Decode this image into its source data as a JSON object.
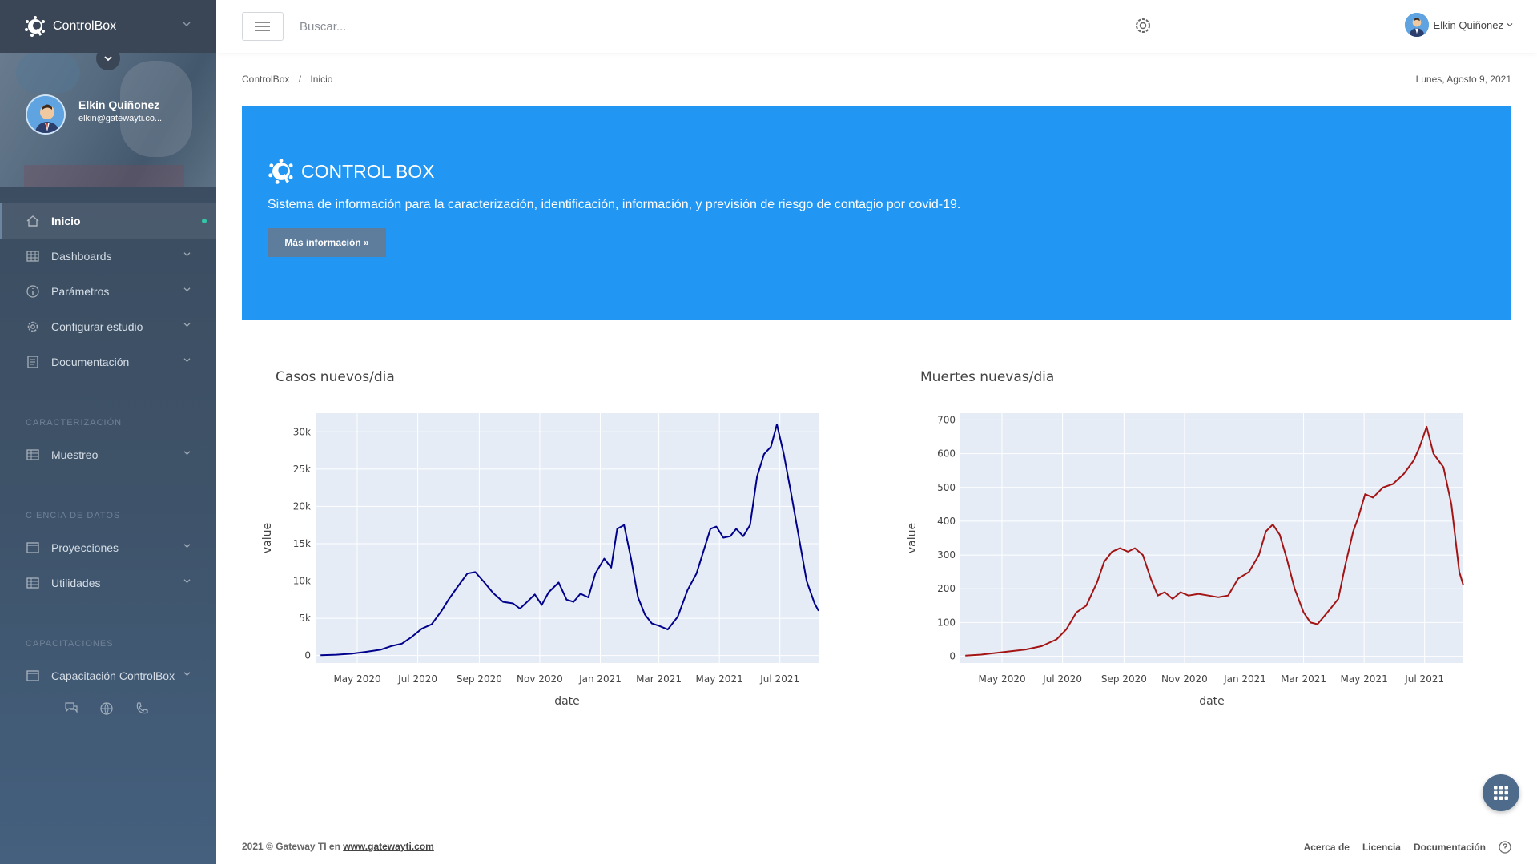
{
  "app": {
    "brand_name": "ControlBox"
  },
  "sidebar": {
    "user_name": "Elkin Quiñonez",
    "user_email": "elkin@gatewayti.co...",
    "items_main": [
      {
        "label": "Inicio",
        "icon": "home-icon",
        "active": true
      },
      {
        "label": "Dashboards",
        "icon": "grid-icon"
      },
      {
        "label": "Parámetros",
        "icon": "info-icon"
      },
      {
        "label": "Configurar estudio",
        "icon": "gear-icon"
      },
      {
        "label": "Documentación",
        "icon": "document-icon"
      }
    ],
    "section_caracterizacion": "CARACTERIZACIÓN",
    "item_muestreo": "Muestreo",
    "section_ciencia": "CIENCIA DE DATOS",
    "item_proyecciones": "Proyecciones",
    "item_utilidades": "Utilidades",
    "section_capacitaciones": "CAPACITACIONES",
    "item_capacitacion": "Capacitación ControlBox"
  },
  "topbar": {
    "search_placeholder": "Buscar...",
    "user_name": "Elkin Quiñonez"
  },
  "breadcrumb": {
    "root": "ControlBox",
    "sep": "/",
    "current": "Inicio"
  },
  "date_text": "Lunes, Agosto 9, 2021",
  "hero": {
    "title": "CONTROL BOX",
    "description": "Sistema de información para la caracterización, identificación, información, y previsión de riesgo de contagio por covid-19.",
    "button_label": "Más información »",
    "background_color": "#2196f3"
  },
  "footer": {
    "copyright": "2021 © Gateway TI en ",
    "link": "www.gatewayti.com",
    "about": "Acerca de",
    "license": "Licencia",
    "docs": "Documentación"
  },
  "chart_data": [
    {
      "type": "line",
      "title": "Casos nuevos/dia",
      "xlabel": "date",
      "ylabel": "value",
      "color": "#00008b",
      "xlim": [
        "2020-03-20",
        "2021-08-09"
      ],
      "ylim": [
        -1000,
        32500
      ],
      "yticks": [
        0,
        5000,
        10000,
        15000,
        20000,
        25000,
        30000
      ],
      "ytick_labels": [
        "0",
        "5k",
        "10k",
        "15k",
        "20k",
        "25k",
        "30k"
      ],
      "xticks": [
        "2020-05-01",
        "2020-07-01",
        "2020-09-01",
        "2020-11-01",
        "2021-01-01",
        "2021-03-01",
        "2021-05-01",
        "2021-07-01"
      ],
      "xtick_labels": [
        "May 2020",
        "Jul 2020",
        "Sep 2020",
        "Nov 2020",
        "Jan 2021",
        "Mar 2021",
        "May 2021",
        "Jul 2021"
      ],
      "grid": true,
      "series": [
        {
          "x": [
            "2020-03-25",
            "2020-04-10",
            "2020-04-25",
            "2020-05-10",
            "2020-05-25",
            "2020-06-05",
            "2020-06-15",
            "2020-06-25",
            "2020-07-05",
            "2020-07-15",
            "2020-07-25",
            "2020-08-01",
            "2020-08-10",
            "2020-08-20",
            "2020-08-28",
            "2020-09-05",
            "2020-09-15",
            "2020-09-25",
            "2020-10-05",
            "2020-10-12",
            "2020-10-20",
            "2020-10-27",
            "2020-11-03",
            "2020-11-10",
            "2020-11-20",
            "2020-11-28",
            "2020-12-05",
            "2020-12-12",
            "2020-12-20",
            "2020-12-27",
            "2021-01-05",
            "2021-01-12",
            "2021-01-18",
            "2021-01-25",
            "2021-02-01",
            "2021-02-08",
            "2021-02-15",
            "2021-02-22",
            "2021-03-01",
            "2021-03-10",
            "2021-03-20",
            "2021-03-30",
            "2021-04-08",
            "2021-04-15",
            "2021-04-22",
            "2021-04-28",
            "2021-05-05",
            "2021-05-12",
            "2021-05-18",
            "2021-05-25",
            "2021-06-01",
            "2021-06-08",
            "2021-06-15",
            "2021-06-22",
            "2021-06-28",
            "2021-07-05",
            "2021-07-12",
            "2021-07-20",
            "2021-07-28",
            "2021-08-05",
            "2021-08-09"
          ],
          "y": [
            50,
            120,
            250,
            500,
            800,
            1300,
            1600,
            2500,
            3600,
            4200,
            6000,
            7500,
            9200,
            11000,
            11200,
            10000,
            8400,
            7200,
            7000,
            6300,
            7300,
            8200,
            6800,
            8500,
            9800,
            7500,
            7200,
            8300,
            7800,
            11000,
            13000,
            11800,
            17000,
            17500,
            13000,
            7800,
            5500,
            4300,
            4000,
            3500,
            5200,
            8800,
            11000,
            14000,
            17000,
            17300,
            15800,
            16000,
            17000,
            16000,
            17500,
            24000,
            27000,
            28000,
            31000,
            27000,
            22000,
            16000,
            10000,
            7000,
            6000
          ]
        }
      ]
    },
    {
      "type": "line",
      "title": "Muertes nuevas/dia",
      "xlabel": "date",
      "ylabel": "value",
      "color": "#a31515",
      "xlim": [
        "2020-03-20",
        "2021-08-09"
      ],
      "ylim": [
        -20,
        720
      ],
      "yticks": [
        0,
        100,
        200,
        300,
        400,
        500,
        600,
        700
      ],
      "ytick_labels": [
        "0",
        "100",
        "200",
        "300",
        "400",
        "500",
        "600",
        "700"
      ],
      "xticks": [
        "2020-05-01",
        "2020-07-01",
        "2020-09-01",
        "2020-11-01",
        "2021-01-01",
        "2021-03-01",
        "2021-05-01",
        "2021-07-01"
      ],
      "xtick_labels": [
        "May 2020",
        "Jul 2020",
        "Sep 2020",
        "Nov 2020",
        "Jan 2021",
        "Mar 2021",
        "May 2021",
        "Jul 2021"
      ],
      "grid": true,
      "series": [
        {
          "x": [
            "2020-03-25",
            "2020-04-10",
            "2020-04-25",
            "2020-05-10",
            "2020-05-25",
            "2020-06-10",
            "2020-06-25",
            "2020-07-05",
            "2020-07-15",
            "2020-07-25",
            "2020-08-05",
            "2020-08-12",
            "2020-08-20",
            "2020-08-28",
            "2020-09-05",
            "2020-09-12",
            "2020-09-20",
            "2020-09-28",
            "2020-10-05",
            "2020-10-12",
            "2020-10-20",
            "2020-10-28",
            "2020-11-05",
            "2020-11-15",
            "2020-11-25",
            "2020-12-05",
            "2020-12-15",
            "2020-12-25",
            "2021-01-05",
            "2021-01-15",
            "2021-01-22",
            "2021-01-29",
            "2021-02-05",
            "2021-02-12",
            "2021-02-20",
            "2021-03-01",
            "2021-03-08",
            "2021-03-15",
            "2021-03-25",
            "2021-04-05",
            "2021-04-12",
            "2021-04-20",
            "2021-04-25",
            "2021-05-02",
            "2021-05-10",
            "2021-05-20",
            "2021-05-30",
            "2021-06-10",
            "2021-06-20",
            "2021-06-26",
            "2021-07-03",
            "2021-07-10",
            "2021-07-20",
            "2021-07-28",
            "2021-08-05",
            "2021-08-09"
          ],
          "y": [
            2,
            5,
            10,
            15,
            20,
            30,
            50,
            80,
            130,
            150,
            220,
            280,
            310,
            320,
            310,
            320,
            300,
            230,
            180,
            190,
            170,
            190,
            180,
            185,
            180,
            175,
            180,
            230,
            250,
            300,
            370,
            390,
            360,
            290,
            200,
            130,
            100,
            95,
            130,
            170,
            270,
            370,
            410,
            480,
            470,
            500,
            510,
            540,
            580,
            620,
            680,
            600,
            560,
            450,
            250,
            210
          ]
        }
      ]
    }
  ]
}
